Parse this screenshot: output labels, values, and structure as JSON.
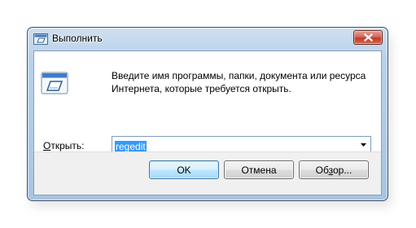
{
  "window": {
    "title": "Выполнить",
    "title_icon": "run-dialog-icon",
    "close_icon": "close-icon"
  },
  "content": {
    "icon": "run-program-icon",
    "description": "Введите имя программы, папки, документа или ресурса Интернета, которые требуется открыть.",
    "open_label_accel": "О",
    "open_label_rest": "ткрыть:",
    "input_value": "regedit",
    "dropdown_icon": "chevron-down-icon"
  },
  "buttons": {
    "ok": "OK",
    "cancel": "Отмена",
    "browse_pre": "Об",
    "browse_accel": "з",
    "browse_post": "ор..."
  },
  "colors": {
    "selection": "#3399ff",
    "close_button": "#c13a2a",
    "title_bar": "#b9d1ea",
    "default_button_border": "#3c7fb1"
  }
}
